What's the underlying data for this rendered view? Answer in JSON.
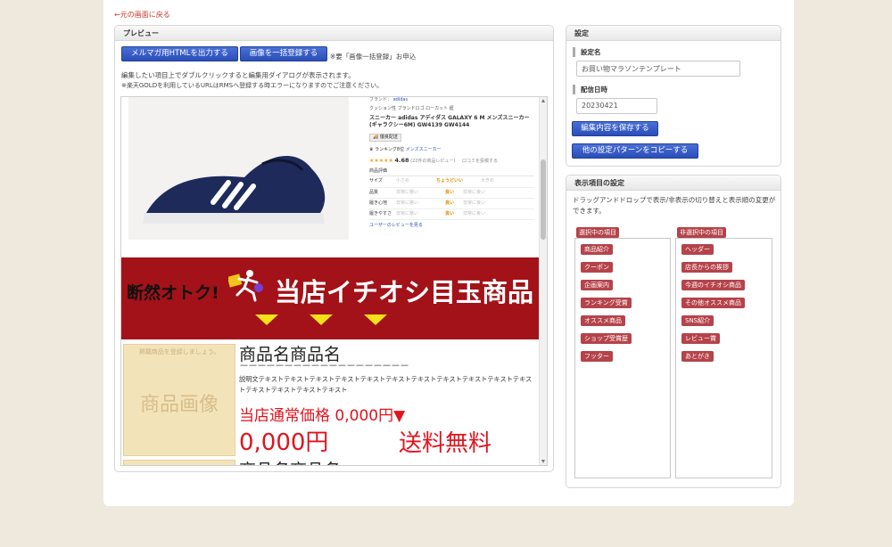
{
  "back_link": "←元の画面に戻る",
  "preview": {
    "title": "プレビュー",
    "btn_export": "メルマガ用HTMLを出力する",
    "btn_register": "画像を一括登録する",
    "register_note": "※要「画像一括登録」お申込",
    "hint": "編集したい項目上でダブルクリックすると編集用ダイアログが表示されます。",
    "warning": "※楽天GOLDを利用しているURLはRMSへ登録する時エラーになりますのでご注意ください。"
  },
  "product_top": {
    "brand_prefix": "ブランド： ",
    "brand_name": "adidas",
    "category": "クッション性 ブランドロゴ ローカット 紐",
    "name": "スニーカー adidas アディダス GALAXY 6 M メンズスニーカー (ギャラクシー6M) GW4139 GW4144",
    "delivery": "優良配送",
    "ranking_prefix": "ランキング8位",
    "ranking_category": "メンズスニーカー",
    "stars": "★★★★★",
    "rating": "4.68",
    "review_count": "(22件の商品レビュー)",
    "review_link": "口コミを投稿する",
    "eval_title": "商品評価",
    "eval_rows": [
      {
        "label": "サイズ",
        "left": "小さめ",
        "mid": "ちょうどいい",
        "right": "大きめ"
      },
      {
        "label": "品質",
        "left": "非常に悪い",
        "mid": "良い",
        "right": "非常に良い"
      },
      {
        "label": "履き心地",
        "left": "非常に悪い",
        "mid": "良い",
        "right": "非常に良い"
      },
      {
        "label": "履きやすさ",
        "left": "非常に悪い",
        "mid": "良い",
        "right": "非常に良い"
      }
    ],
    "user_review_link": "ユーザーのレビューを見る"
  },
  "banner": {
    "left": "断然オトク!",
    "main": "当店イチオシ目玉商品"
  },
  "item": {
    "image_placeholder": "商品画像",
    "register_hint": "掲載商品を登録しましょう。",
    "name": "商品名商品名",
    "dashes": "－－－－－－－－－－－－－－－－－－－",
    "desc": "説明文テキストテキストテキストテキストテキストテキストテキストテキストテキストテキストテキストテキストテキストテキストテキスト",
    "regular_price": "当店通常価格 0,000円▼",
    "price": "0,000円",
    "shipping": "送料無料",
    "next_name": "商品名商品名"
  },
  "settings": {
    "title": "設定",
    "name_label": "設定名",
    "name_value": "お買い物マラソンテンプレート",
    "date_label": "配信日時",
    "date_value": "20230421",
    "btn_save": "編集内容を保存する",
    "btn_copy": "他の設定パターンをコピーする"
  },
  "display": {
    "title": "表示項目の設定",
    "desc": "ドラッグアンドドロップで表示/非表示の切り替えと表示順の変更ができます。",
    "selected_title": "選択中の項目",
    "unselected_title": "非選択中の項目",
    "selected": [
      "商品紹介",
      "クーポン",
      "企画案内",
      "ランキング受賞",
      "オススメ商品",
      "ショップ受賞歴",
      "フッター"
    ],
    "unselected": [
      "ヘッダー",
      "店長からの挨拶",
      "今週のイチオシ商品",
      "その他オススメ商品",
      "SNS紹介",
      "レビュー賞",
      "あとがき"
    ]
  },
  "colors": {
    "accent_blue": "#2a4eb8",
    "banner_red": "#a31218",
    "tag_red": "#b5434a",
    "price_red": "#e0141e"
  }
}
